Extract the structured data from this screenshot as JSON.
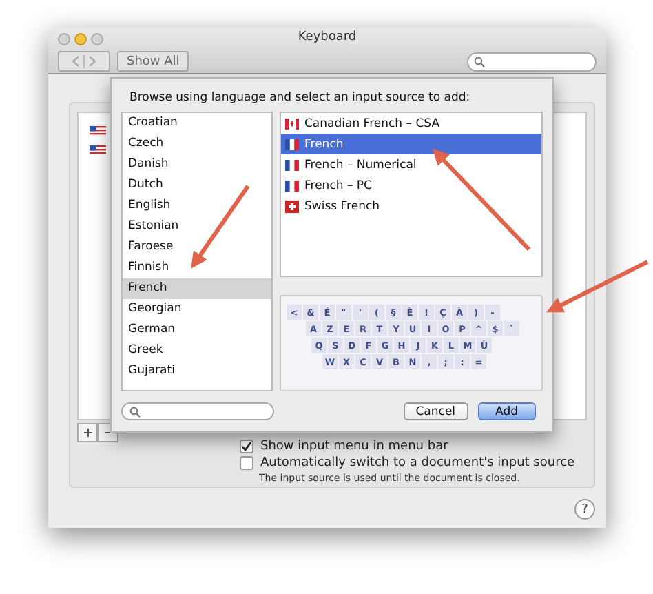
{
  "window": {
    "title": "Keyboard",
    "show_all": "Show All"
  },
  "background_sources": [
    {
      "kind": "us"
    },
    {
      "kind": "us"
    }
  ],
  "options": [
    {
      "label": "Show input menu in menu bar",
      "checked": true
    },
    {
      "label": "Automatically switch to a document's input source",
      "checked": false
    }
  ],
  "note": "The input source is used until the document is closed.",
  "help": "?",
  "sheet": {
    "heading": "Browse using language and select an input source to add:",
    "languages": [
      {
        "label": "Croatian",
        "selected": false
      },
      {
        "label": "Czech",
        "selected": false
      },
      {
        "label": "Danish",
        "selected": false
      },
      {
        "label": "Dutch",
        "selected": false
      },
      {
        "label": "English",
        "selected": false
      },
      {
        "label": "Estonian",
        "selected": false
      },
      {
        "label": "Faroese",
        "selected": false
      },
      {
        "label": "Finnish",
        "selected": false
      },
      {
        "label": "French",
        "selected": true
      },
      {
        "label": "Georgian",
        "selected": false
      },
      {
        "label": "German",
        "selected": false
      },
      {
        "label": "Greek",
        "selected": false
      },
      {
        "label": "Gujarati",
        "selected": false
      }
    ],
    "sources": [
      {
        "label": "Canadian French – CSA",
        "kind": "canada",
        "selected": false
      },
      {
        "label": "French",
        "kind": "france",
        "selected": true
      },
      {
        "label": "French – Numerical",
        "kind": "france",
        "selected": false
      },
      {
        "label": "French – PC",
        "kind": "france",
        "selected": false
      },
      {
        "label": "Swiss French",
        "kind": "swiss",
        "selected": false
      }
    ],
    "keyboard_rows": [
      [
        "<",
        "&",
        "É",
        "\"",
        "'",
        "(",
        "§",
        "È",
        "!",
        "Ç",
        "À",
        ")",
        "-"
      ],
      [
        "A",
        "Z",
        "E",
        "R",
        "T",
        "Y",
        "U",
        "I",
        "O",
        "P",
        "^",
        "$",
        "`"
      ],
      [
        "Q",
        "S",
        "D",
        "F",
        "G",
        "H",
        "J",
        "K",
        "L",
        "M",
        "Ù"
      ],
      [
        "W",
        "X",
        "C",
        "V",
        "B",
        "N",
        ",",
        ";",
        ":",
        "="
      ]
    ],
    "buttons": [
      {
        "label": "Cancel",
        "kind": "normal"
      },
      {
        "label": "Add",
        "kind": "default"
      }
    ]
  }
}
